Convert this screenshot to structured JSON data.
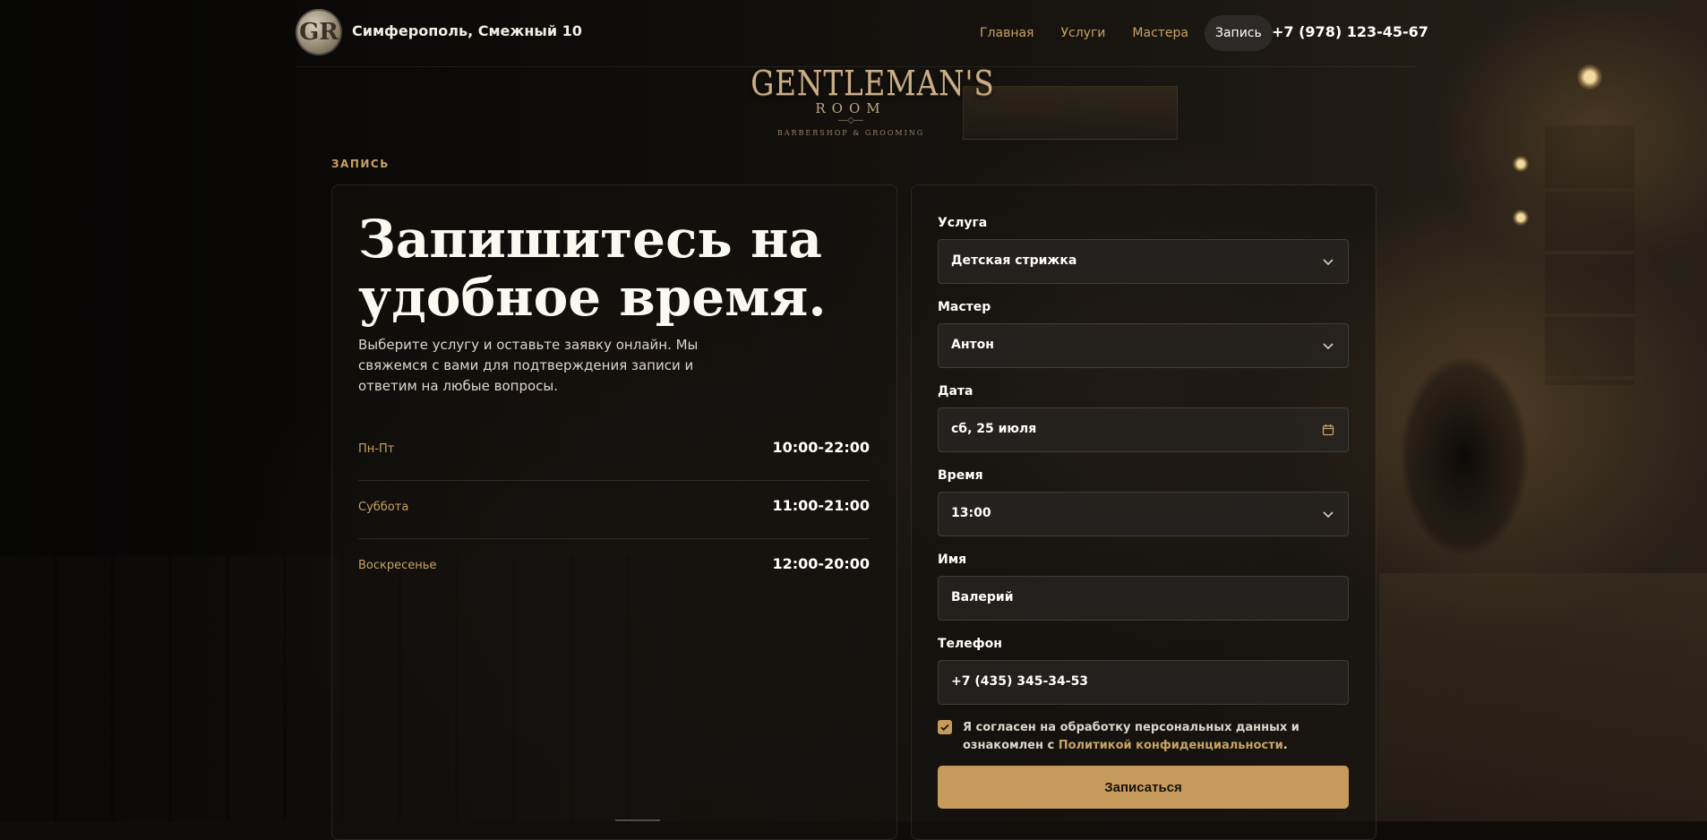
{
  "header": {
    "logo_letters": "GR",
    "address": "Симферополь, Смежный 10",
    "nav": [
      {
        "label": "Главная"
      },
      {
        "label": "Услуги"
      },
      {
        "label": "Мастера"
      },
      {
        "label": "Запись",
        "active": true
      }
    ],
    "phone": "+7 (978) 123-45-67"
  },
  "brand": {
    "title": "GENTLEMAN'S",
    "subtitle": "ROOM",
    "tagline": "BARBERSHOP & GROOMING"
  },
  "section_label": "ЗАПИСЬ",
  "hero": {
    "title": "Запишитесь на удобное время.",
    "description": "Выберите услугу и оставьте заявку онлайн. Мы свяжемся с вами для подтверждения записи и ответим на любые вопросы."
  },
  "hours": [
    {
      "day": "Пн-Пт",
      "time": "10:00-22:00"
    },
    {
      "day": "Суббота",
      "time": "11:00-21:00"
    },
    {
      "day": "Воскресенье",
      "time": "12:00-20:00"
    }
  ],
  "form": {
    "service": {
      "label": "Услуга",
      "value": "Детская стрижка",
      "icon": "chevron-down-icon"
    },
    "master": {
      "label": "Мастер",
      "value": "Антон",
      "icon": "chevron-down-icon"
    },
    "date": {
      "label": "Дата",
      "value": "сб, 25 июля",
      "icon": "calendar-icon"
    },
    "time": {
      "label": "Время",
      "value": "13:00",
      "icon": "chevron-down-icon"
    },
    "name": {
      "label": "Имя",
      "value": "Валерий"
    },
    "phone": {
      "label": "Телефон",
      "value": "+7 (435) 345-34-53"
    },
    "consent": {
      "checked": true,
      "text": "Я согласен на обработку персональных данных и ознакомлен с",
      "link": "Политикой конфиденциальности",
      "suffix": "."
    },
    "submit": "Записаться"
  },
  "colors": {
    "accent": "#c9a163",
    "button": "#c69a5a",
    "background": "#0f0d0a",
    "card": "#14120f"
  }
}
